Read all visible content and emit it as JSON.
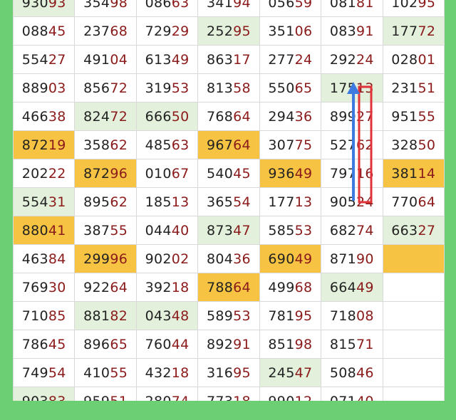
{
  "colors": {
    "frame": "#6dcf74",
    "cell_green": "#e3f1dc",
    "cell_orange": "#f6c343",
    "prefix_text": "#222222",
    "suffix_text": "#8b1a1a",
    "arrow": "#3d7be0",
    "highlight_box": "#e0333a"
  },
  "grid": {
    "rows": [
      [
        {
          "p": "930",
          "s": "93",
          "bg": "green"
        },
        {
          "p": "354",
          "s": "98",
          "bg": "white"
        },
        {
          "p": "086",
          "s": "63",
          "bg": "white"
        },
        {
          "p": "341",
          "s": "94",
          "bg": "white"
        },
        {
          "p": "056",
          "s": "59",
          "bg": "white"
        },
        {
          "p": "081",
          "s": "81",
          "bg": "white"
        },
        {
          "p": "102",
          "s": "95",
          "bg": "white"
        }
      ],
      [
        {
          "p": "088",
          "s": "45",
          "bg": "white"
        },
        {
          "p": "237",
          "s": "68",
          "bg": "white"
        },
        {
          "p": "729",
          "s": "29",
          "bg": "white"
        },
        {
          "p": "252",
          "s": "95",
          "bg": "green"
        },
        {
          "p": "351",
          "s": "06",
          "bg": "white"
        },
        {
          "p": "083",
          "s": "91",
          "bg": "white"
        },
        {
          "p": "177",
          "s": "72",
          "bg": "green"
        }
      ],
      [
        {
          "p": "554",
          "s": "27",
          "bg": "white"
        },
        {
          "p": "491",
          "s": "04",
          "bg": "white"
        },
        {
          "p": "613",
          "s": "49",
          "bg": "white"
        },
        {
          "p": "863",
          "s": "17",
          "bg": "white"
        },
        {
          "p": "277",
          "s": "24",
          "bg": "white"
        },
        {
          "p": "292",
          "s": "24",
          "bg": "white"
        },
        {
          "p": "028",
          "s": "01",
          "bg": "white"
        }
      ],
      [
        {
          "p": "889",
          "s": "03",
          "bg": "white"
        },
        {
          "p": "856",
          "s": "72",
          "bg": "white"
        },
        {
          "p": "319",
          "s": "53",
          "bg": "white"
        },
        {
          "p": "813",
          "s": "58",
          "bg": "white"
        },
        {
          "p": "550",
          "s": "65",
          "bg": "white"
        },
        {
          "p": "175",
          "s": "13",
          "bg": "green"
        },
        {
          "p": "231",
          "s": "51",
          "bg": "white"
        }
      ],
      [
        {
          "p": "466",
          "s": "38",
          "bg": "white"
        },
        {
          "p": "824",
          "s": "72",
          "bg": "green"
        },
        {
          "p": "666",
          "s": "50",
          "bg": "green"
        },
        {
          "p": "768",
          "s": "64",
          "bg": "white"
        },
        {
          "p": "294",
          "s": "36",
          "bg": "white"
        },
        {
          "p": "899",
          "s": "27",
          "bg": "white"
        },
        {
          "p": "951",
          "s": "55",
          "bg": "white"
        }
      ],
      [
        {
          "p": "872",
          "s": "19",
          "bg": "orange"
        },
        {
          "p": "358",
          "s": "62",
          "bg": "white"
        },
        {
          "p": "485",
          "s": "63",
          "bg": "white"
        },
        {
          "p": "967",
          "s": "64",
          "bg": "orange"
        },
        {
          "p": "307",
          "s": "75",
          "bg": "white"
        },
        {
          "p": "527",
          "s": "62",
          "bg": "white"
        },
        {
          "p": "328",
          "s": "50",
          "bg": "white"
        }
      ],
      [
        {
          "p": "202",
          "s": "22",
          "bg": "white"
        },
        {
          "p": "872",
          "s": "96",
          "bg": "orange"
        },
        {
          "p": "010",
          "s": "67",
          "bg": "white"
        },
        {
          "p": "540",
          "s": "45",
          "bg": "white"
        },
        {
          "p": "936",
          "s": "49",
          "bg": "orange"
        },
        {
          "p": "797",
          "s": "16",
          "bg": "white"
        },
        {
          "p": "381",
          "s": "14",
          "bg": "orange"
        }
      ],
      [
        {
          "p": "554",
          "s": "31",
          "bg": "green"
        },
        {
          "p": "895",
          "s": "62",
          "bg": "white"
        },
        {
          "p": "185",
          "s": "13",
          "bg": "white"
        },
        {
          "p": "365",
          "s": "54",
          "bg": "white"
        },
        {
          "p": "177",
          "s": "13",
          "bg": "white"
        },
        {
          "p": "905",
          "s": "24",
          "bg": "white"
        },
        {
          "p": "770",
          "s": "64",
          "bg": "white"
        }
      ],
      [
        {
          "p": "880",
          "s": "41",
          "bg": "orange"
        },
        {
          "p": "387",
          "s": "55",
          "bg": "white"
        },
        {
          "p": "044",
          "s": "40",
          "bg": "white"
        },
        {
          "p": "873",
          "s": "47",
          "bg": "green"
        },
        {
          "p": "585",
          "s": "53",
          "bg": "white"
        },
        {
          "p": "682",
          "s": "74",
          "bg": "white"
        },
        {
          "p": "663",
          "s": "27",
          "bg": "green"
        }
      ],
      [
        {
          "p": "463",
          "s": "84",
          "bg": "white"
        },
        {
          "p": "299",
          "s": "96",
          "bg": "orange"
        },
        {
          "p": "902",
          "s": "02",
          "bg": "white"
        },
        {
          "p": "804",
          "s": "36",
          "bg": "white"
        },
        {
          "p": "690",
          "s": "49",
          "bg": "orange"
        },
        {
          "p": "871",
          "s": "90",
          "bg": "white"
        },
        {
          "p": "",
          "s": "",
          "bg": "orange"
        }
      ],
      [
        {
          "p": "769",
          "s": "30",
          "bg": "white"
        },
        {
          "p": "922",
          "s": "64",
          "bg": "white"
        },
        {
          "p": "392",
          "s": "18",
          "bg": "white"
        },
        {
          "p": "788",
          "s": "64",
          "bg": "orange"
        },
        {
          "p": "499",
          "s": "68",
          "bg": "white"
        },
        {
          "p": "664",
          "s": "49",
          "bg": "green"
        },
        {
          "p": "",
          "s": "",
          "bg": "white"
        }
      ],
      [
        {
          "p": "710",
          "s": "85",
          "bg": "white"
        },
        {
          "p": "881",
          "s": "82",
          "bg": "green"
        },
        {
          "p": "043",
          "s": "48",
          "bg": "green"
        },
        {
          "p": "589",
          "s": "53",
          "bg": "white"
        },
        {
          "p": "781",
          "s": "95",
          "bg": "white"
        },
        {
          "p": "718",
          "s": "08",
          "bg": "white"
        },
        {
          "p": "",
          "s": "",
          "bg": "white"
        }
      ],
      [
        {
          "p": "786",
          "s": "45",
          "bg": "white"
        },
        {
          "p": "896",
          "s": "65",
          "bg": "white"
        },
        {
          "p": "760",
          "s": "44",
          "bg": "white"
        },
        {
          "p": "892",
          "s": "91",
          "bg": "white"
        },
        {
          "p": "851",
          "s": "98",
          "bg": "white"
        },
        {
          "p": "815",
          "s": "71",
          "bg": "white"
        },
        {
          "p": "",
          "s": "",
          "bg": "white"
        }
      ],
      [
        {
          "p": "749",
          "s": "54",
          "bg": "white"
        },
        {
          "p": "410",
          "s": "55",
          "bg": "white"
        },
        {
          "p": "432",
          "s": "18",
          "bg": "white"
        },
        {
          "p": "316",
          "s": "95",
          "bg": "white"
        },
        {
          "p": "245",
          "s": "47",
          "bg": "green"
        },
        {
          "p": "508",
          "s": "46",
          "bg": "white"
        },
        {
          "p": "",
          "s": "",
          "bg": "white"
        }
      ],
      [
        {
          "p": "903",
          "s": "83",
          "bg": "green"
        },
        {
          "p": "959",
          "s": "51",
          "bg": "white"
        },
        {
          "p": "280",
          "s": "74",
          "bg": "white"
        },
        {
          "p": "773",
          "s": "18",
          "bg": "white"
        },
        {
          "p": "990",
          "s": "12",
          "bg": "white"
        },
        {
          "p": "071",
          "s": "40",
          "bg": "white"
        },
        {
          "p": "",
          "s": "",
          "bg": "white"
        }
      ]
    ]
  },
  "annotations": {
    "arrow_icon": "up-arrow-icon",
    "box_icon": "highlight-box"
  }
}
